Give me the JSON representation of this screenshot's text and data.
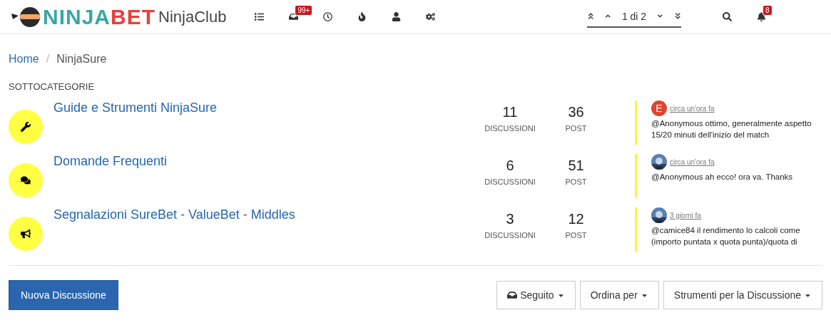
{
  "header": {
    "logo": {
      "first": "NINJA",
      "second": "BET"
    },
    "site_name": "NinjaClub",
    "nav_items": [
      {
        "kind": "list"
      },
      {
        "kind": "inbox",
        "badge": "99+"
      },
      {
        "kind": "recent"
      },
      {
        "kind": "popular"
      },
      {
        "kind": "user"
      },
      {
        "kind": "admin"
      }
    ],
    "pagination": {
      "label": "1 di 2"
    },
    "notifications": {
      "badge": "8"
    }
  },
  "breadcrumb": [
    {
      "label": "Home",
      "link": true
    },
    {
      "separator": "/",
      "label": "NinjaSure",
      "link": false
    }
  ],
  "section_title": "SOTTOCATEGORIE",
  "categories": [
    {
      "kind": "wrench",
      "title": "Guide e Strumenti NinjaSure",
      "discussions": "11",
      "discussions_label": "DISCUSSIONI",
      "posts": "36",
      "posts_label": "POST",
      "last_post": {
        "avatar": {
          "kind": "letter",
          "letter": "E",
          "color": "#e0432f"
        },
        "time": "circa un'ora fa",
        "text": "@Anonymous ottimo, generalmente aspetto 15/20 minuti dell'inizio del match"
      }
    },
    {
      "kind": "comments",
      "title": "Domande Frequenti",
      "discussions": "6",
      "discussions_label": "DISCUSSIONI",
      "posts": "51",
      "posts_label": "POST",
      "last_post": {
        "time": "circa un'ora fa",
        "text": "@Anonymous ah ecco! ora va. Thanks"
      }
    },
    {
      "kind": "bullhorn",
      "title": "Segnalazioni SureBet - ValueBet - Middles",
      "discussions": "3",
      "discussions_label": "DISCUSSIONI",
      "posts": "12",
      "posts_label": "POST",
      "last_post": {
        "time": "3 giorni fa",
        "text": "@camice84 il rendimento lo calcoli come (importo puntata x quota punta)/quota di"
      }
    }
  ],
  "footer": {
    "primary_button": "Nuova Discussione",
    "buttons": [
      {
        "kind": "watch",
        "label": "Seguito"
      },
      {
        "kind": "plain",
        "label": "Ordina per"
      },
      {
        "kind": "plain",
        "label": "Strumenti per la Discussione"
      }
    ]
  }
}
